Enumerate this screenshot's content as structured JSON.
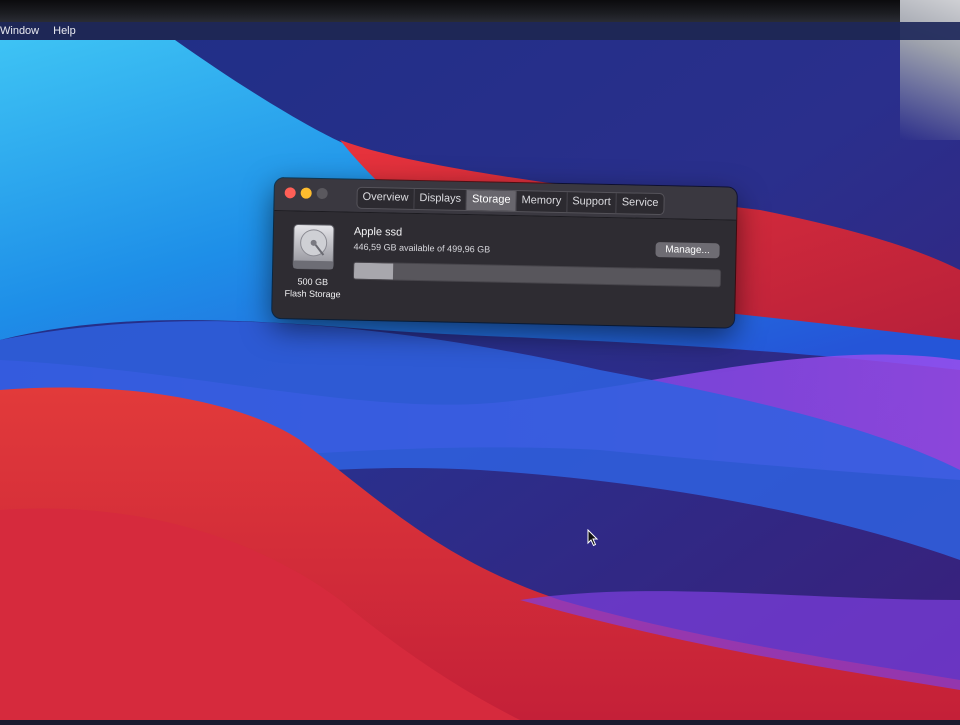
{
  "menubar": {
    "items": [
      "Window",
      "Help"
    ]
  },
  "window": {
    "tabs": [
      {
        "label": "Overview",
        "active": false
      },
      {
        "label": "Displays",
        "active": false
      },
      {
        "label": "Storage",
        "active": true
      },
      {
        "label": "Memory",
        "active": false
      },
      {
        "label": "Support",
        "active": false
      },
      {
        "label": "Service",
        "active": false
      }
    ],
    "disk": {
      "icon": "hard-drive-icon",
      "capacity": "500 GB",
      "type": "Flash Storage"
    },
    "volume": {
      "name": "Apple ssd",
      "availability": "446,59 GB available of 499,96 GB",
      "used_fraction": 0.107
    },
    "manage_label": "Manage..."
  },
  "colors": {
    "close": "#ff5f57",
    "minimize": "#febc2e",
    "zoom_disabled": "#5a585e",
    "window_bg": "#2e2c32"
  }
}
